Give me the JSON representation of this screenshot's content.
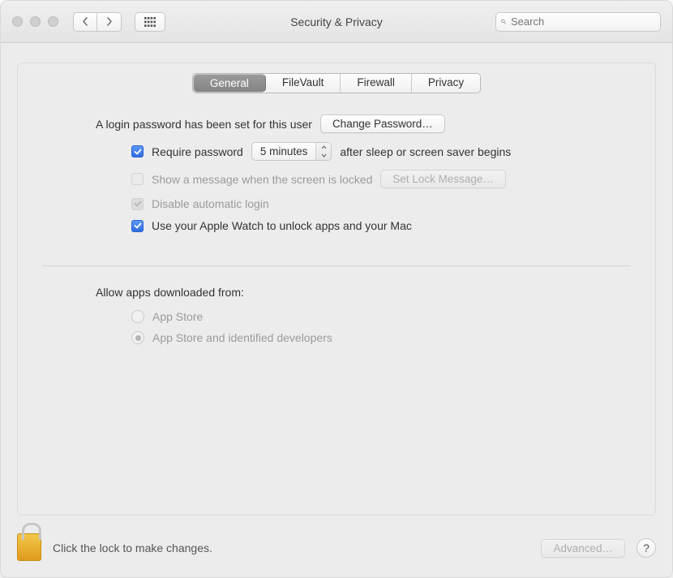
{
  "window": {
    "title": "Security & Privacy"
  },
  "search": {
    "placeholder": "Search"
  },
  "tabs": {
    "general": "General",
    "filevault": "FileVault",
    "firewall": "Firewall",
    "privacy": "Privacy",
    "selected": "general"
  },
  "general": {
    "login_password_set": "A login password has been set for this user",
    "change_password": "Change Password…",
    "require_password_label": "Require password",
    "require_password_delay": "5 minutes",
    "require_password_suffix": "after sleep or screen saver begins",
    "show_message_label": "Show a message when the screen is locked",
    "set_lock_message": "Set Lock Message…",
    "disable_auto_login": "Disable automatic login",
    "apple_watch_unlock": "Use your Apple Watch to unlock apps and your Mac",
    "checks": {
      "require_password": true,
      "show_message": false,
      "disable_auto_login": true,
      "apple_watch": true
    }
  },
  "allow_apps": {
    "heading": "Allow apps downloaded from:",
    "app_store": "App Store",
    "app_store_identified": "App Store and identified developers",
    "selected": "app_store_identified"
  },
  "footer": {
    "lock_msg": "Click the lock to make changes.",
    "advanced": "Advanced…",
    "help": "?"
  }
}
